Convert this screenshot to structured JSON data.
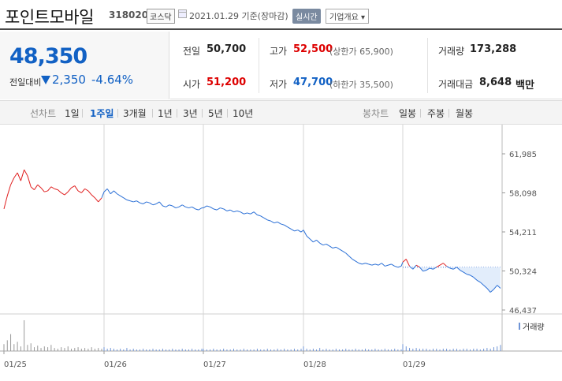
{
  "header": {
    "title": "포인트모바일",
    "code": "318020",
    "market": "코스닥",
    "date_text": "2021.01.29  기준(장마감)",
    "realtime_label": "실시간",
    "company_label": "기업개요 ▾"
  },
  "price": {
    "current": "48,350",
    "change_label": "전일대비",
    "change_value": "2,350",
    "change_pct": "-4.64%"
  },
  "stats": {
    "prev_close_label": "전일",
    "prev_close": "50,700",
    "open_label": "시가",
    "open": "51,200",
    "high_label": "고가",
    "high": "52,500",
    "upper_limit": "(상한가 65,900)",
    "low_label": "저가",
    "low": "47,700",
    "lower_limit": "(하한가 35,500)",
    "volume_label": "거래량",
    "volume": "173,288",
    "amount_label": "거래대금",
    "amount": "8,648",
    "amount_unit": "백만"
  },
  "tabs": {
    "line_label": "선차트",
    "line_tabs": [
      "1일",
      "1주일",
      "3개월",
      "1년",
      "3년",
      "5년",
      "10년"
    ],
    "active_index": 1,
    "candle_label": "봉차트",
    "candle_tabs": [
      "일봉",
      "주봉",
      "월봉"
    ]
  },
  "colors": {
    "up": "#e02020",
    "down": "#1261c4",
    "line_blue": "#2a6fd6",
    "fill_blue": "#e2edfb"
  },
  "chart_data": {
    "type": "line",
    "x_labels": [
      "01/25",
      "01/26",
      "01/27",
      "01/28",
      "01/29"
    ],
    "y_ticks": [
      "61,985",
      "58,098",
      "54,211",
      "50,324",
      "46,437"
    ],
    "ylim": [
      46437,
      61985
    ],
    "prev_close": 50700,
    "volume_legend": "거래량",
    "days": [
      {
        "label": "01/25",
        "series": [
          56500,
          57800,
          58900,
          59600,
          60100,
          59300,
          60400,
          59800,
          58700,
          58400,
          58900,
          58600,
          58200,
          58300,
          58700,
          58500,
          58400,
          58100,
          57900,
          58200,
          58600,
          58800,
          58300,
          58100,
          58500,
          58300,
          57900,
          57600,
          57200,
          57600
        ]
      },
      {
        "label": "01/26",
        "series": [
          58200,
          58500,
          58000,
          58300,
          58000,
          57800,
          57600,
          57400,
          57300,
          57200,
          57300,
          57100,
          57000,
          57200,
          57100,
          56900,
          57000,
          57200,
          56800,
          56700,
          56900,
          56800,
          56600,
          56700,
          56900,
          56700,
          56600,
          56700,
          56500,
          56400,
          56600
        ]
      },
      {
        "label": "01/27",
        "series": [
          56600,
          56800,
          56700,
          56500,
          56400,
          56600,
          56500,
          56300,
          56400,
          56200,
          56300,
          56200,
          56000,
          56100,
          56000,
          56200,
          55900,
          55800,
          55600,
          55400,
          55300,
          55100,
          55200,
          55000,
          54900,
          54700,
          54500,
          54300,
          54400,
          54200
        ]
      },
      {
        "label": "01/28",
        "series": [
          54400,
          53800,
          53500,
          53200,
          53400,
          53100,
          52900,
          53000,
          52800,
          52600,
          52700,
          52500,
          52300,
          52100,
          51800,
          51500,
          51300,
          51100,
          51000,
          51100,
          51000,
          50900,
          51000,
          50900,
          51100,
          50800,
          50900,
          51000,
          50800,
          50700,
          50800
        ]
      },
      {
        "label": "01/29",
        "series": [
          51200,
          51500,
          50800,
          50500,
          50900,
          50700,
          50300,
          50400,
          50600,
          50500,
          50700,
          50900,
          51100,
          50800,
          50600,
          50500,
          50700,
          50400,
          50200,
          50000,
          49900,
          49700,
          49400,
          49200,
          48900,
          48600,
          48200,
          48500,
          48900,
          48600
        ]
      }
    ],
    "volume_days": [
      [
        9,
        14,
        22,
        9,
        12,
        6,
        40,
        8,
        10,
        5,
        7,
        4,
        6,
        5,
        8,
        4,
        3,
        5,
        4,
        6,
        3,
        4,
        5,
        3,
        4,
        3,
        5,
        3,
        4,
        3
      ],
      [
        5,
        3,
        4,
        3,
        2,
        3,
        2,
        4,
        2,
        3,
        2,
        2,
        3,
        2,
        2,
        3,
        2,
        2,
        3,
        2,
        2,
        3,
        2,
        2,
        3,
        2,
        2,
        3,
        2,
        2,
        3
      ],
      [
        3,
        2,
        2,
        3,
        2,
        2,
        3,
        2,
        2,
        3,
        2,
        2,
        3,
        2,
        2,
        2,
        3,
        2,
        2,
        3,
        2,
        2,
        3,
        2,
        3,
        2,
        2,
        3,
        2,
        3
      ],
      [
        6,
        3,
        2,
        3,
        2,
        4,
        2,
        3,
        2,
        2,
        3,
        2,
        2,
        3,
        2,
        2,
        3,
        2,
        2,
        3,
        2,
        2,
        3,
        2,
        2,
        3,
        2,
        2,
        3,
        2,
        2
      ],
      [
        9,
        6,
        4,
        3,
        4,
        3,
        3,
        3,
        2,
        3,
        3,
        2,
        3,
        3,
        2,
        3,
        3,
        2,
        3,
        3,
        2,
        3,
        3,
        2,
        3,
        4,
        3,
        5,
        6,
        8
      ]
    ]
  }
}
